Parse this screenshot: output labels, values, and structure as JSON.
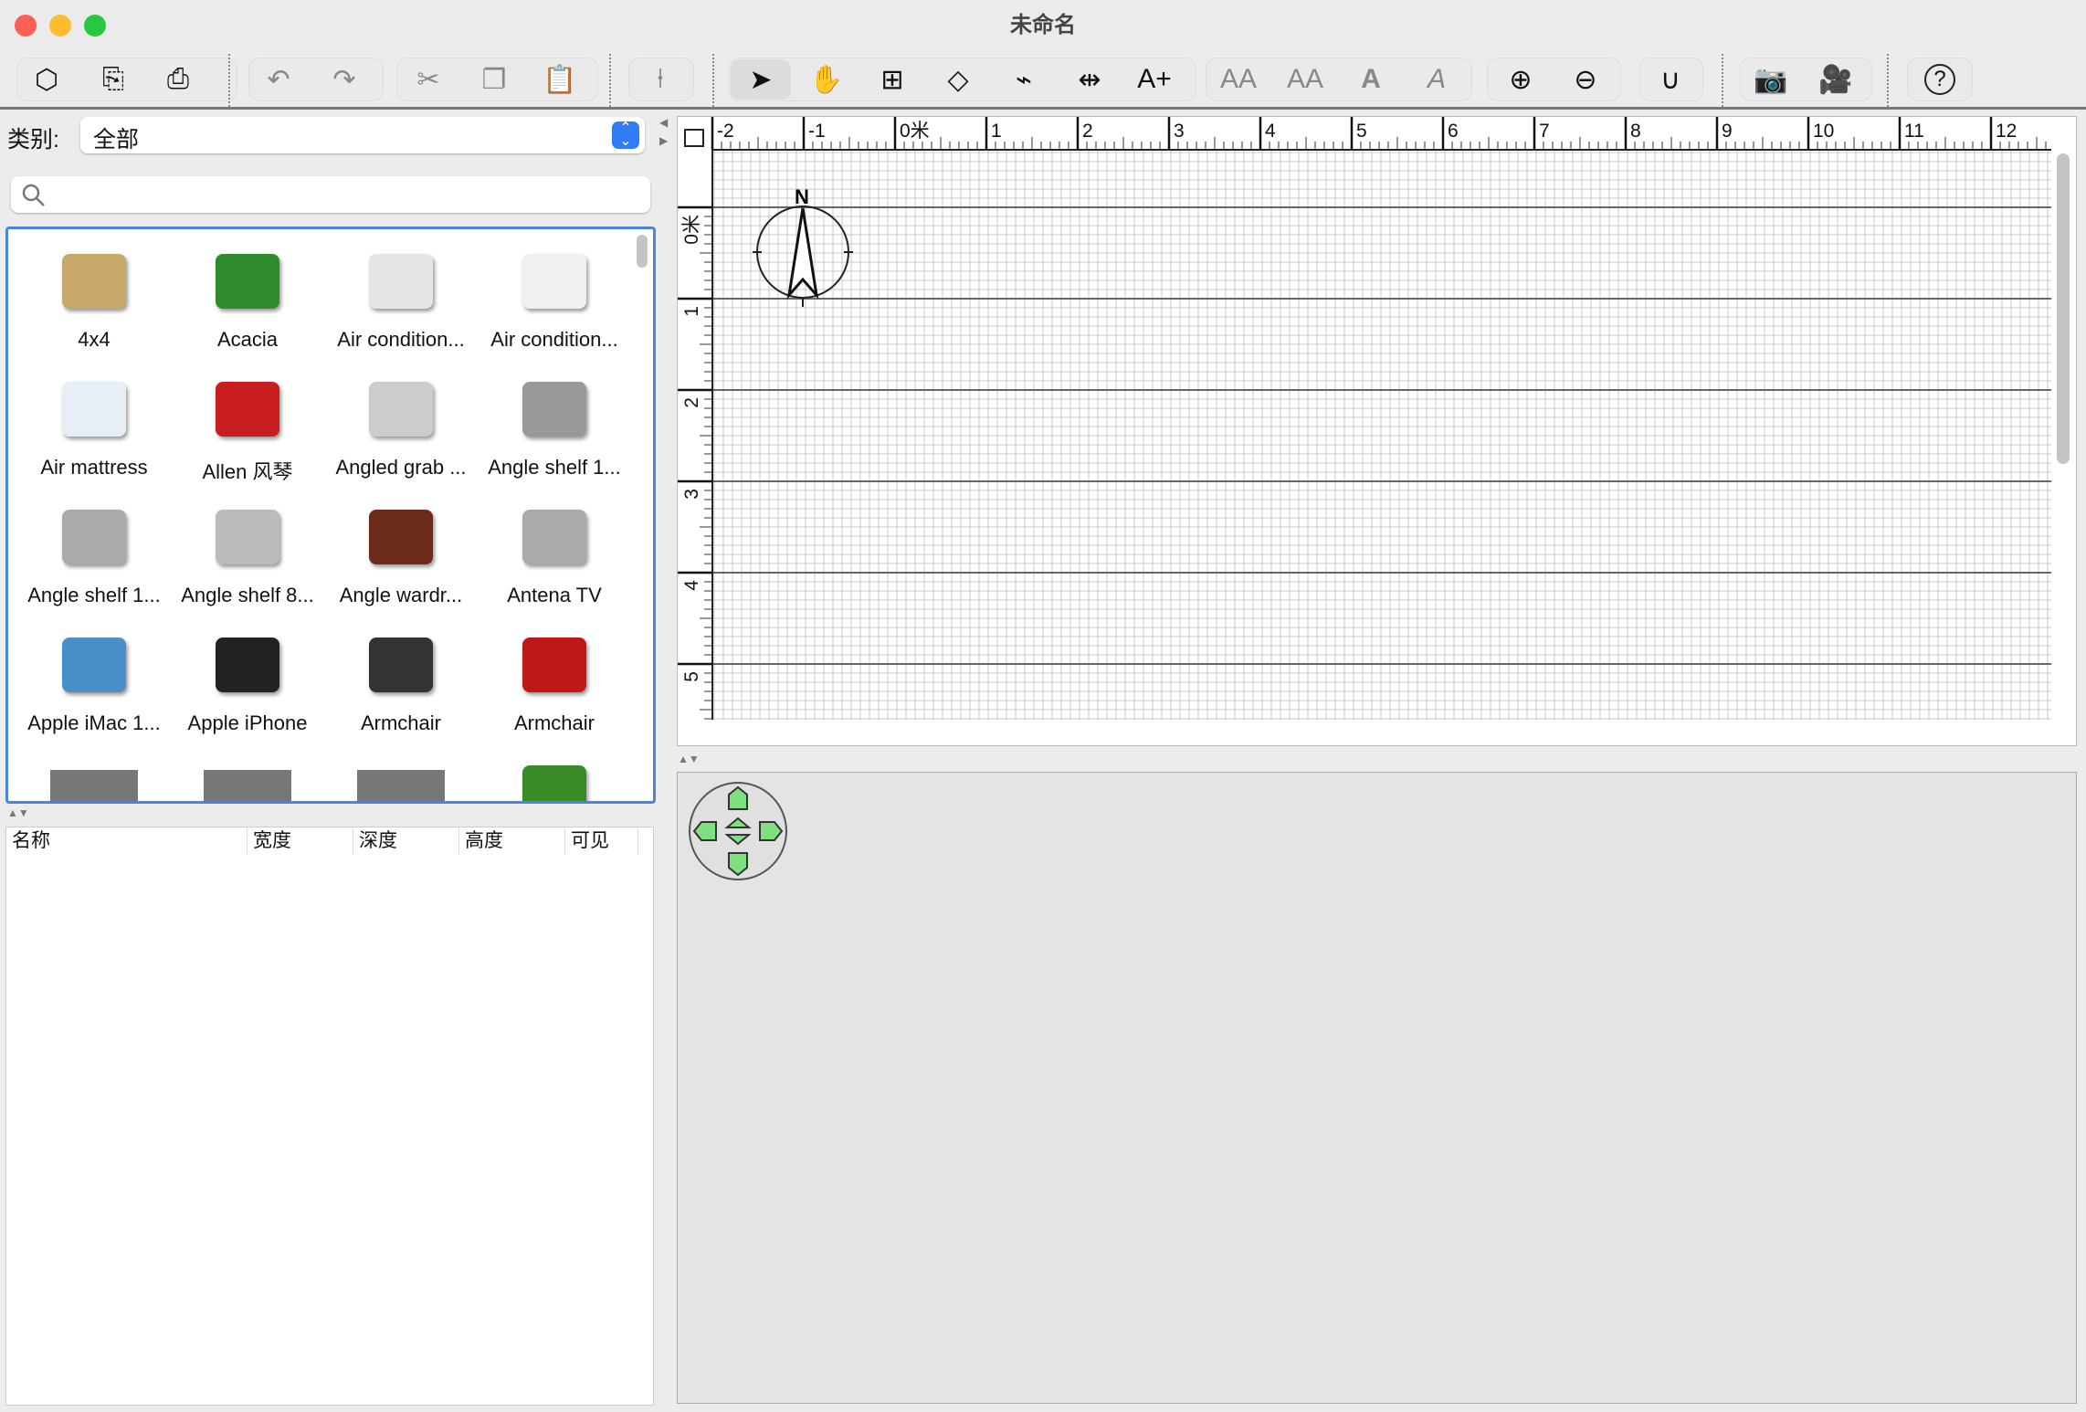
{
  "window": {
    "title": "未命名"
  },
  "colors": {
    "accent": "#2f7cf6",
    "selection_border": "#4a84e0",
    "nav_green": "#7fe07f"
  },
  "toolbar": {
    "buttons": [
      {
        "name": "new-home-button",
        "icon": "new-icon"
      },
      {
        "name": "open-button",
        "icon": "open-icon"
      },
      {
        "name": "save-button",
        "icon": "save-icon"
      },
      {
        "name": "undo-button",
        "icon": "undo-icon"
      },
      {
        "name": "redo-button",
        "icon": "redo-icon"
      },
      {
        "name": "cut-button",
        "icon": "scissors-icon"
      },
      {
        "name": "copy-button",
        "icon": "copy-icon"
      },
      {
        "name": "paste-button",
        "icon": "paste-icon"
      },
      {
        "name": "add-furniture-button",
        "icon": "add-furniture-icon"
      },
      {
        "name": "select-mode-button",
        "icon": "pointer-icon"
      },
      {
        "name": "pan-mode-button",
        "icon": "hand-icon"
      },
      {
        "name": "create-walls-button",
        "icon": "wall-icon"
      },
      {
        "name": "create-rooms-button",
        "icon": "room-icon"
      },
      {
        "name": "create-polylines-button",
        "icon": "polyline-icon"
      },
      {
        "name": "create-dimensions-button",
        "icon": "dimension-icon"
      },
      {
        "name": "add-text-button",
        "icon": "add-text-icon",
        "label": "A+"
      },
      {
        "name": "increase-text-size-button",
        "icon": "text-bigger-icon",
        "label": "AA"
      },
      {
        "name": "decrease-text-size-button",
        "icon": "text-smaller-icon",
        "label": "AA"
      },
      {
        "name": "bold-button",
        "icon": "bold-icon",
        "label": "A"
      },
      {
        "name": "italic-button",
        "icon": "italic-icon",
        "label": "A"
      },
      {
        "name": "zoom-in-button",
        "icon": "zoom-in-icon"
      },
      {
        "name": "zoom-out-button",
        "icon": "zoom-out-icon"
      },
      {
        "name": "magnetism-button",
        "icon": "magnet-icon"
      },
      {
        "name": "create-photo-button",
        "icon": "camera-icon"
      },
      {
        "name": "create-video-button",
        "icon": "video-camera-icon"
      },
      {
        "name": "help-button",
        "icon": "help-icon",
        "label": "?"
      }
    ]
  },
  "catalog": {
    "category_label": "类别:",
    "category_value": "全部",
    "search_placeholder": "",
    "items": [
      {
        "label": "4x4",
        "color": "#c8a86a"
      },
      {
        "label": "Acacia",
        "color": "#2e8b2e"
      },
      {
        "label": "Air condition...",
        "color": "#e6e6e6"
      },
      {
        "label": "Air condition...",
        "color": "#f0f0f0"
      },
      {
        "label": "Air mattress",
        "color": "#e8eef5"
      },
      {
        "label": "Allen 风琴",
        "color": "#c81e1e"
      },
      {
        "label": "Angled grab ...",
        "color": "#cccccc"
      },
      {
        "label": "Angle shelf 1...",
        "color": "#999999"
      },
      {
        "label": "Angle shelf 1...",
        "color": "#aaaaaa"
      },
      {
        "label": "Angle shelf 8...",
        "color": "#bbbbbb"
      },
      {
        "label": "Angle wardr...",
        "color": "#6b2a1a"
      },
      {
        "label": "Antena TV",
        "color": "#aaaaaa"
      },
      {
        "label": "Apple iMac 1...",
        "color": "#4a90c8"
      },
      {
        "label": "Apple iPhone",
        "color": "#222222"
      },
      {
        "label": "Armchair",
        "color": "#333333"
      },
      {
        "label": "Armchair",
        "color": "#c01818"
      },
      {
        "label": "",
        "color": "#777777"
      },
      {
        "label": "",
        "color": "#777777"
      },
      {
        "label": "",
        "color": "#777777"
      },
      {
        "label": "",
        "color": "#3a8a2a"
      }
    ]
  },
  "furniture_table": {
    "columns": [
      "名称",
      "宽度",
      "深度",
      "高度",
      "可见"
    ]
  },
  "plan": {
    "unit": "米",
    "x_labels": [
      "-2",
      "-1",
      "0米",
      "1",
      "2",
      "3",
      "4",
      "5",
      "6",
      "7",
      "8",
      "9",
      "10",
      "11",
      "12"
    ],
    "y_labels": [
      "0米",
      "1",
      "2",
      "3",
      "4",
      "5"
    ],
    "compass": "N"
  }
}
